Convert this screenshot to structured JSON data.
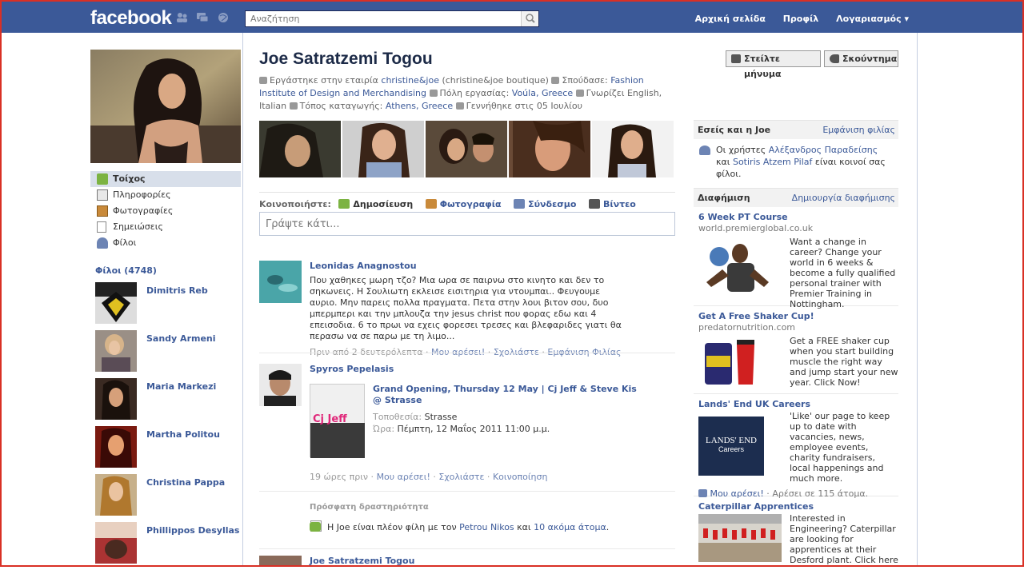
{
  "topbar": {
    "logo": "facebook",
    "search_placeholder": "Αναζήτηση",
    "nav": [
      "Αρχική σελίδα",
      "Προφίλ",
      "Λογαριασμός ▾"
    ]
  },
  "profile": {
    "name": "Joe Satratzemi Togou",
    "info": {
      "worked_prefix": "Εργάστηκε στην εταιρία",
      "company": "christine&joe",
      "company_note": "(christine&joe boutique)",
      "studied_prefix": "Σπούδασε:",
      "school": "Fashion Institute of Design and Merchandising",
      "city_prefix": "Πόλη εργασίας:",
      "city": "Voúla, Greece",
      "languages": "Γνωρίζει English, Italian",
      "home_prefix": "Τόπος καταγωγής:",
      "home": "Athens, Greece",
      "birthday": "Γεννήθηκε στις 05 Ιουλίου"
    },
    "actions": {
      "message": "Στείλτε μήνυμα",
      "poke": "Σκούντημα"
    }
  },
  "left_nav": [
    "Τοίχος",
    "Πληροφορίες",
    "Φωτογραφίες",
    "Σημειώσεις",
    "Φίλοι"
  ],
  "friends": {
    "heading": "Φίλοι (4748)",
    "list": [
      "Dimitris Reb",
      "Sandy Armeni",
      "Maria Markezi",
      "Martha Politou",
      "Christina Pappa",
      "Phillippos Desyllas"
    ]
  },
  "share": {
    "label": "Κοινοποιήστε:",
    "options": [
      "Δημοσίευση",
      "Φωτογραφία",
      "Σύνδεσμο",
      "Βίντεο"
    ],
    "composer_placeholder": "Γράψτε κάτι..."
  },
  "feed": {
    "story1": {
      "author": "Leonidas Anagnostou",
      "text": "Που χαθηκες μωρη τζο? Μια ωρα σε παιρνω στο κινητο και δεν το σηκωνεις. Η Σουλιωτη εκλεισε εισιτηρια για ντουμπαι.. Φευγουμε αυριο. Μην παρεις πολλα πραγματα. Πετα στην λουι βιτον σου, δυο μπερμπερι και την μπλουζα την jesus christ που φορας εδω και 4 επεισοδια. 6 το πρωι να εχεις φορεσει τρεσες και βλεφαριδες γιατι θα περασω να σε παρω με τη λιμο...",
      "time": "Πριν από 2 δευτερόλεπτα",
      "like": "Μου αρέσει!",
      "comment": "Σχολιάστε",
      "friendship": "Εμφάνιση Φιλίας"
    },
    "story2": {
      "author": "Spyros Pepelasis",
      "event_title": "Grand Opening, Thursday 12 May | Cj Jeff & Steve Kis @ Strasse",
      "poster_text": "Cj Jeff",
      "location_label": "Τοποθεσία:",
      "location": "Strasse",
      "time_label": "Ώρα:",
      "time_value": "Πέμπτη, 12 Μαΐος 2011 11:00 μ.μ.",
      "time": "19 ώρες πριν",
      "like": "Μου αρέσει!",
      "comment": "Σχολιάστε",
      "share": "Κοινοποίηση"
    },
    "recent": {
      "heading": "Πρόσφατη δραστηριότητα",
      "prefix": "Η Joe είναι πλέον φίλη με τον",
      "friend": "Petrou Nikos",
      "connector": "και",
      "more": "10 ακόμα άτομα",
      "suffix": "."
    },
    "story3": {
      "author": "Joe Satratzemi Togou"
    }
  },
  "right": {
    "mutual": {
      "heading": "Εσείς και η Joe",
      "link": "Εμφάνιση φιλίας",
      "prefix": "Οι χρήστες",
      "friend1": "Αλέξανδρος Παραδείσης",
      "connector": "και",
      "friend2": "Sotiris Atzem Pilaf",
      "suffix": "είναι κοινοί σας φίλοι."
    },
    "ads_heading": "Διαφήμιση",
    "ads_link": "Δημιουργία διαφήμισης",
    "ads": [
      {
        "title": "6 Week PT Course",
        "url": "world.premierglobal.co.uk",
        "text": "Want a change in career? Change your world in 6 weeks & become a fully qualified personal trainer with Premier Training in Nottingham."
      },
      {
        "title": "Get A Free Shaker Cup!",
        "url": "predatornutrition.com",
        "text": "Get a FREE shaker cup when you start building muscle the right way and jump start your new year. Click Now!"
      },
      {
        "title": "Lands' End UK Careers",
        "url": "",
        "text": "'Like' our page to keep up to date with vacancies, news, employee events, charity fundraisers, local happenings and much more.",
        "logo_line1": "LANDS' END",
        "logo_line2": "Careers",
        "like": "Μου αρέσει!",
        "likes_count": "Αρέσει σε 115 άτομα."
      },
      {
        "title": "Caterpillar Apprentices",
        "url": "",
        "text": "Interested in Engineering? Caterpillar are looking for apprentices at their Desford plant. Click here"
      }
    ]
  }
}
